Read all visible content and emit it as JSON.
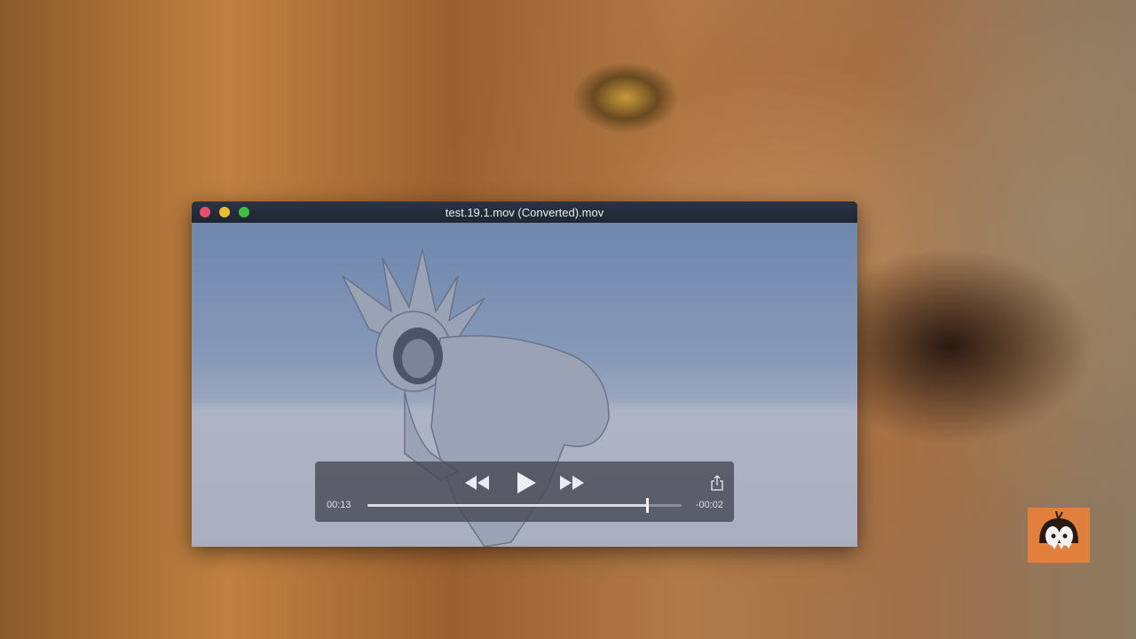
{
  "window": {
    "title": "test.19.1.mov (Converted).mov",
    "traffic_lights": {
      "close": "#e8506a",
      "minimize": "#e8c030",
      "zoom": "#40c040"
    }
  },
  "player": {
    "current_time": "00:13",
    "remaining_time": "-00:02",
    "progress": 0.89,
    "icons": [
      "rewind-icon",
      "play-icon",
      "fast-forward-icon",
      "share-icon"
    ]
  },
  "watermark": {
    "icon": "cartoon-mascot-logo"
  }
}
